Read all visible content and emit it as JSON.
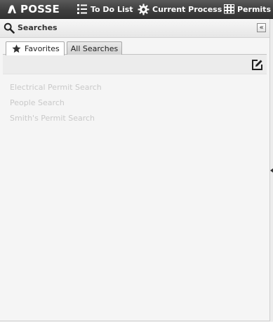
{
  "topbar": {
    "brand": "POSSE",
    "nav": [
      {
        "label": "To Do List",
        "icon": "list-icon"
      },
      {
        "label": "Current Process",
        "icon": "gear-icon"
      },
      {
        "label": "Permits",
        "icon": "grid-icon"
      }
    ]
  },
  "panel": {
    "title": "Searches",
    "collapse_label": "«",
    "tabs": [
      {
        "label": "Favorites",
        "icon": "star-icon",
        "active": true
      },
      {
        "label": "All Searches",
        "active": false
      }
    ],
    "searches": [
      "Electrical Permit Search",
      "People Search",
      "Smith's Permit Search"
    ]
  },
  "colors": {
    "topbar": "#3e3e3e",
    "panel_bg": "#f5f5f5",
    "item_text": "#c9c9c9"
  }
}
